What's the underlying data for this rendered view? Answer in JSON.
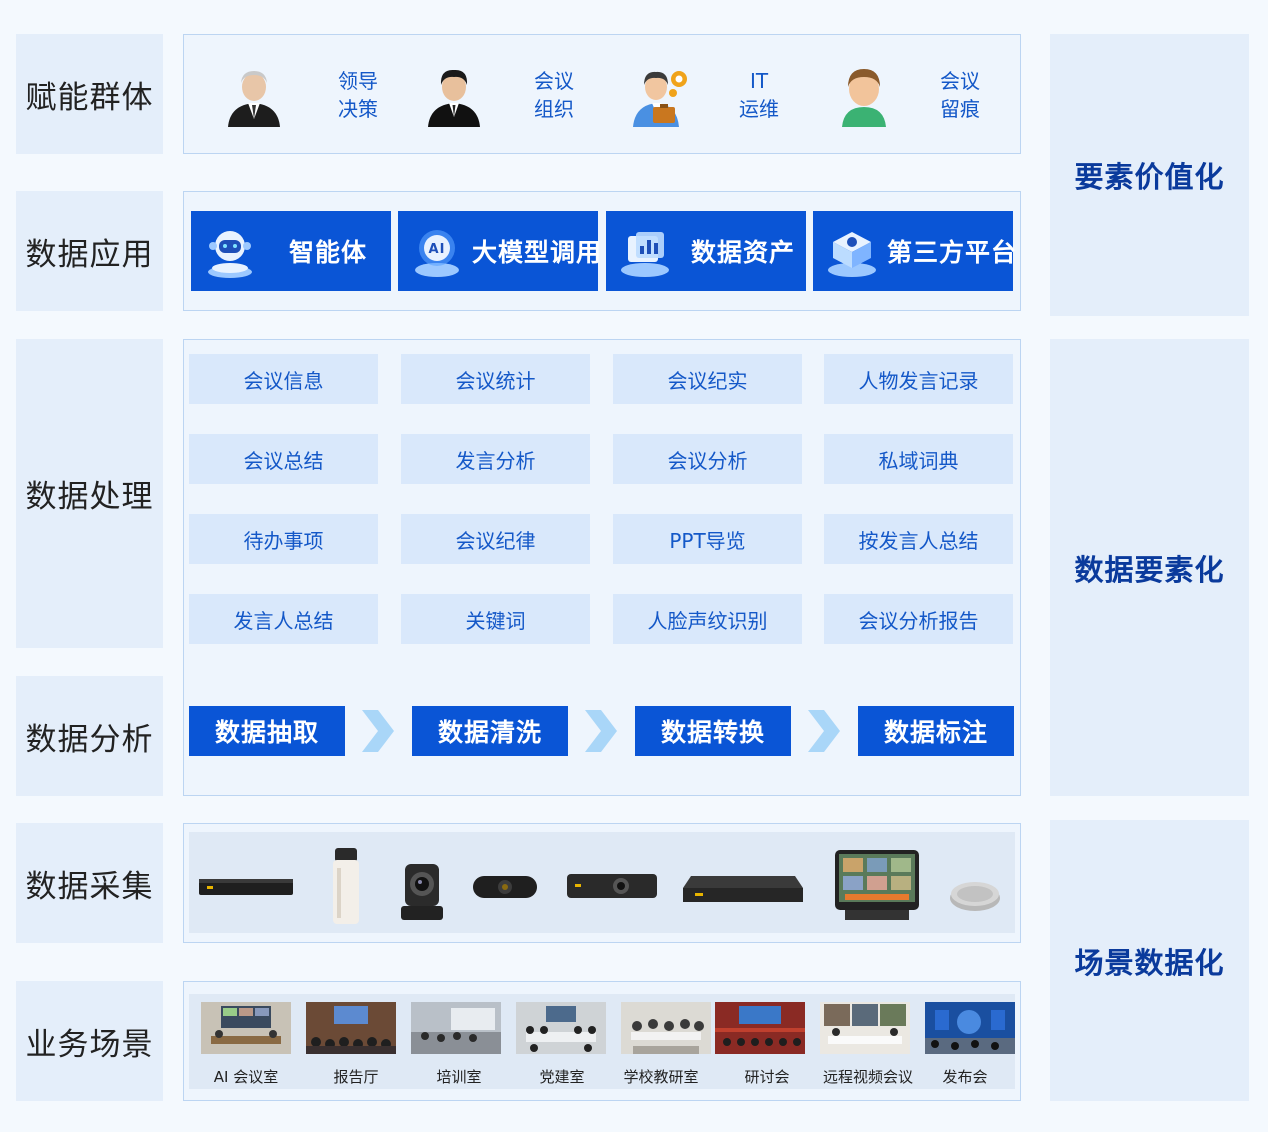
{
  "left_labels": [
    "赋能群体",
    "数据应用",
    "数据处理",
    "数据分析",
    "数据采集",
    "业务场景"
  ],
  "right_labels": [
    "要素价值化",
    "数据要素化",
    "场景数据化"
  ],
  "personas": [
    {
      "label_line1": "领导",
      "label_line2": "决策",
      "icon": "senior-leader-avatar-icon"
    },
    {
      "label_line1": "会议",
      "label_line2": "组织",
      "icon": "businessman-avatar-icon"
    },
    {
      "label_line1": "IT",
      "label_line2": "运维",
      "icon": "it-engineer-avatar-icon"
    },
    {
      "label_line1": "会议",
      "label_line2": "留痕",
      "icon": "user-avatar-icon"
    }
  ],
  "apps": [
    {
      "label": "智能体",
      "icon": "robot-icon"
    },
    {
      "label": "大模型调用",
      "icon": "ai-model-icon"
    },
    {
      "label": "数据资产",
      "icon": "data-asset-icon"
    },
    {
      "label": "第三方平台",
      "icon": "platform-icon"
    }
  ],
  "processing": [
    [
      "会议信息",
      "会议统计",
      "会议纪实",
      "人物发言记录"
    ],
    [
      "会议总结",
      "发言分析",
      "会议分析",
      "私域词典"
    ],
    [
      "待办事项",
      "会议纪律",
      "PPT导览",
      "按发言人总结"
    ],
    [
      "发言人总结",
      "关键词",
      "人脸声纹识别",
      "会议分析报告"
    ]
  ],
  "analysis": [
    "数据抽取",
    "数据清洗",
    "数据转换",
    "数据标注"
  ],
  "devices": [
    "host-box-icon",
    "cylinder-mic-icon",
    "ptz-camera-icon",
    "webcam-icon",
    "video-bar-icon",
    "server-box-icon",
    "touch-panel-icon",
    "speakerphone-icon"
  ],
  "scenes": [
    "AI 会议室",
    "报告厅",
    "培训室",
    "党建室",
    "学校教研室",
    "研讨会",
    "远程视频会议",
    "发布会"
  ],
  "colors": {
    "primary_blue": "#0a55d6",
    "label_blue": "#1458c8",
    "right_text": "#0a3a9c"
  }
}
